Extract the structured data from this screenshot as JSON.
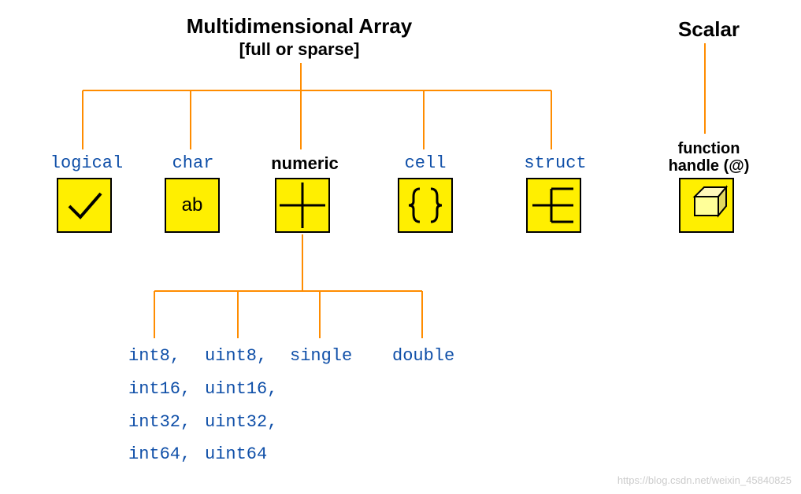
{
  "header": {
    "main": "Multidimensional Array",
    "sub": "[full or sparse]",
    "scalar": "Scalar"
  },
  "types": {
    "logical": "logical",
    "char": "char",
    "numeric": "numeric",
    "cell": "cell",
    "struct": "struct",
    "function_handle_line1": "function",
    "function_handle_line2": "handle (@)"
  },
  "char_glyph": "ab",
  "numeric_children": {
    "col1": "int8,\nint16,\nint32,\nint64,",
    "col2": "uint8,\nuint16,\nuint32,\nuint64",
    "col3": "single",
    "col4": "double"
  },
  "watermark": "https://blog.csdn.net/weixin_45840825"
}
